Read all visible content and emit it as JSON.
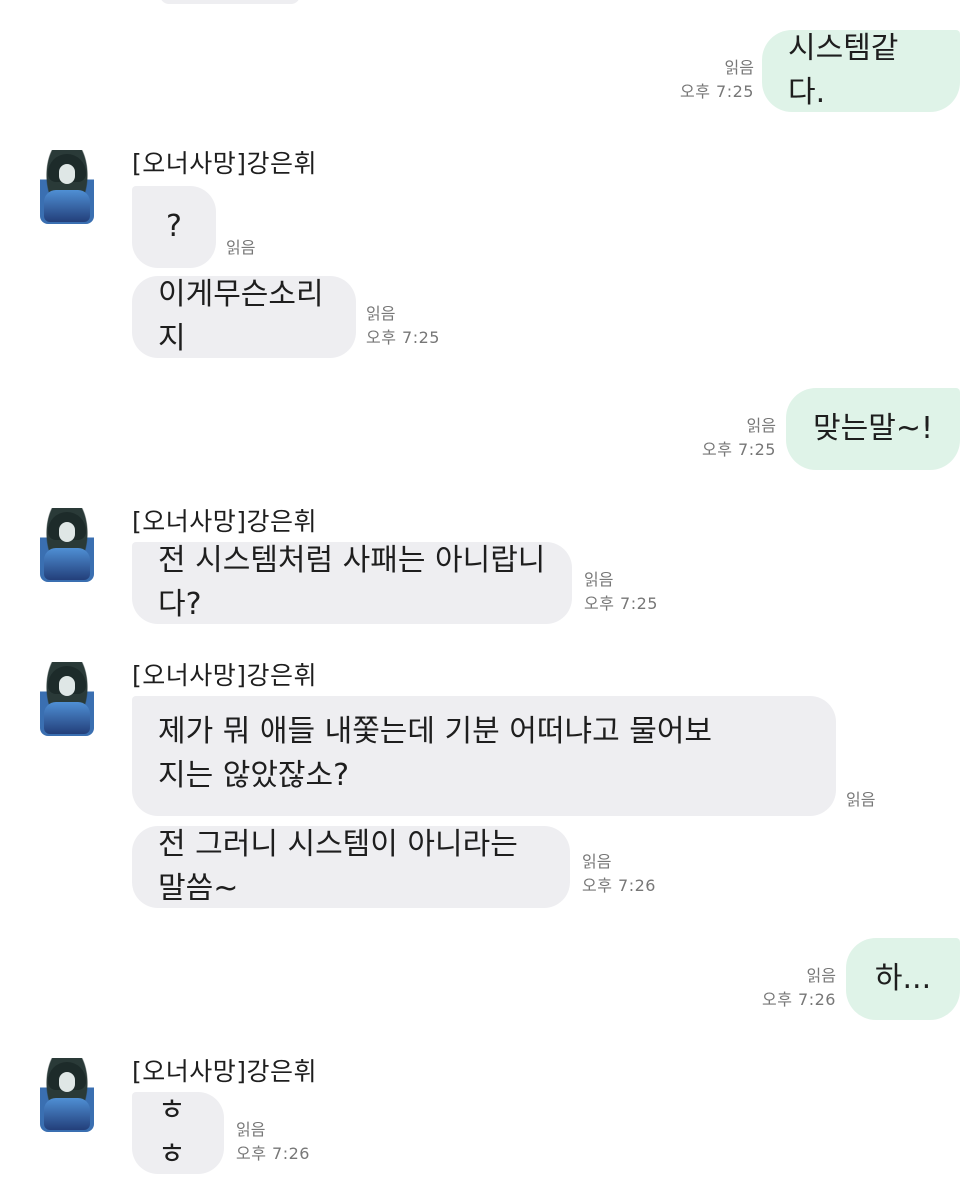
{
  "chat": {
    "contact_name": "[오너사망]강은휘",
    "read_label": "읽음",
    "messages": [
      {
        "text": "시스템같다.",
        "time": "오후 7:25"
      },
      {
        "text": "?"
      },
      {
        "text": "이게무슨소리지",
        "time": "오후 7:25"
      },
      {
        "text": "맞는말~!",
        "time": "오후 7:25"
      },
      {
        "text": "전 시스템처럼 사패는 아니랍니다?",
        "time": "오후 7:25"
      },
      {
        "text": "제가 뭐 애들 내쫓는데 기분 어떠냐고 물어보지는 않았잖소?"
      },
      {
        "text": "전 그러니 시스템이 아니라는 말씀~",
        "time": "오후 7:26"
      },
      {
        "text": "하...",
        "time": "오후 7:26"
      },
      {
        "text": "ㅎㅎ",
        "time": "오후 7:26"
      }
    ]
  },
  "colors": {
    "incoming_bubble": "#eeeef1",
    "outgoing_bubble": "#dff3e8",
    "meta_text": "#777777"
  }
}
